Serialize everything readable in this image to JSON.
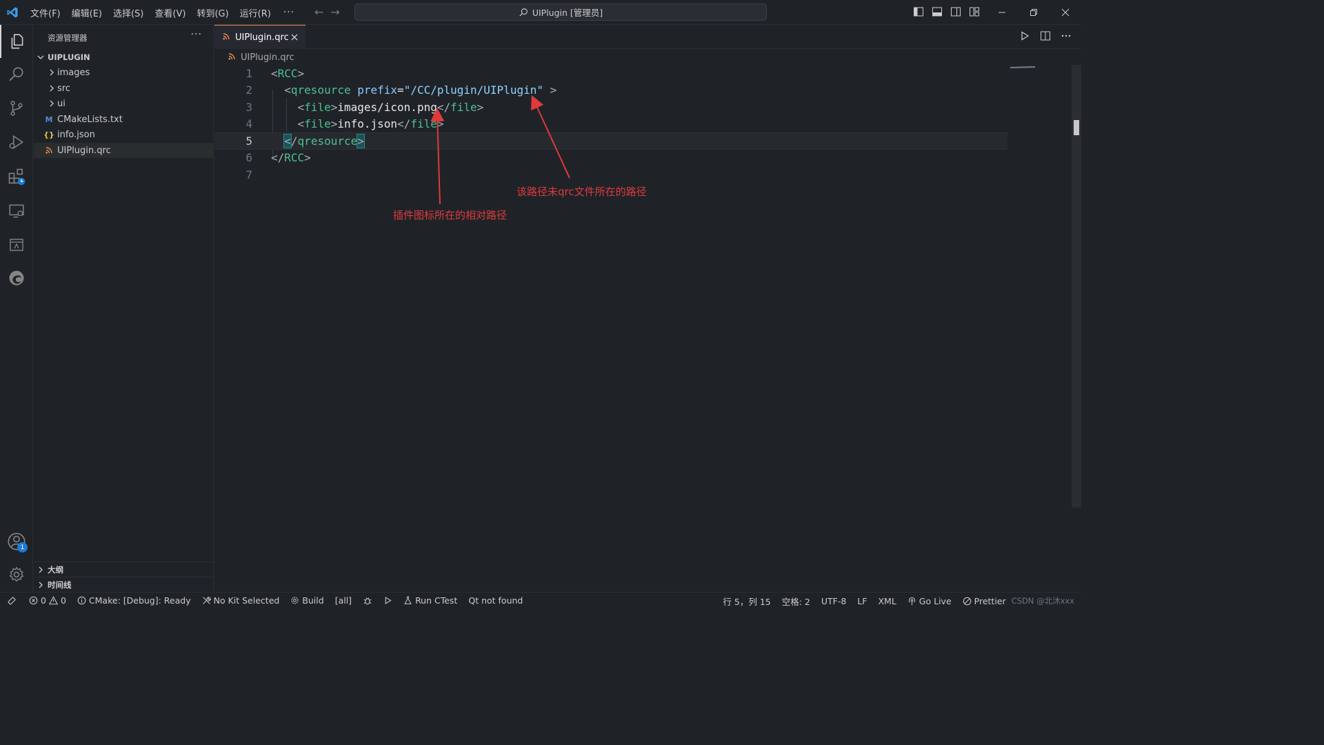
{
  "window": {
    "title": "UIPlugin [管理员]",
    "menu": [
      "文件(F)",
      "编辑(E)",
      "选择(S)",
      "查看(V)",
      "转到(G)",
      "运行(R)"
    ],
    "menu_more": "···"
  },
  "activity_bar": {
    "items": [
      "explorer-icon",
      "search-icon",
      "source-control-icon",
      "run-debug-icon",
      "extensions-icon",
      "remote-explorer-icon",
      "qt-designer-icon",
      "edge-devtools-icon"
    ],
    "accounts_badge": "1"
  },
  "sidebar": {
    "title": "资源管理器",
    "more": "···",
    "section": "UIPLUGIN",
    "tree": [
      {
        "label": "images",
        "kind": "folder"
      },
      {
        "label": "src",
        "kind": "folder"
      },
      {
        "label": "ui",
        "kind": "folder"
      },
      {
        "label": "CMakeLists.txt",
        "kind": "cmake",
        "icon_text": "M"
      },
      {
        "label": "info.json",
        "kind": "json",
        "icon_text": "{}"
      },
      {
        "label": "UIPlugin.qrc",
        "kind": "qrc",
        "selected": true
      }
    ],
    "outline": "大纲",
    "timeline": "时间线"
  },
  "editor": {
    "tab": "UIPlugin.qrc",
    "breadcrumb": "UIPlugin.qrc",
    "current_line": 5,
    "lines": [
      "<RCC>",
      "  <qresource prefix=\"/CC/plugin/UIPlugin\" >",
      "    <file>images/icon.png</file>",
      "    <file>info.json</file>",
      "  </qresource>",
      "</RCC>",
      ""
    ]
  },
  "annotations": {
    "prefix_note": "该路径未qrc文件所在的路径",
    "icon_note": "插件图标所在的相对路径",
    "color": "#e03a3a"
  },
  "statusbar": {
    "errors": "0",
    "warnings": "0",
    "cmake": "CMake: [Debug]: Ready",
    "kit": "No Kit Selected",
    "build": "Build",
    "target": "[all]",
    "ctest": "Run CTest",
    "qt": "Qt not found",
    "position": "行 5，列 15",
    "spaces": "空格: 2",
    "encoding": "UTF-8",
    "eol": "LF",
    "language": "XML",
    "golive": "Go Live",
    "prettier": "Prettier",
    "watermark": "CSDN @北沐xxx"
  }
}
